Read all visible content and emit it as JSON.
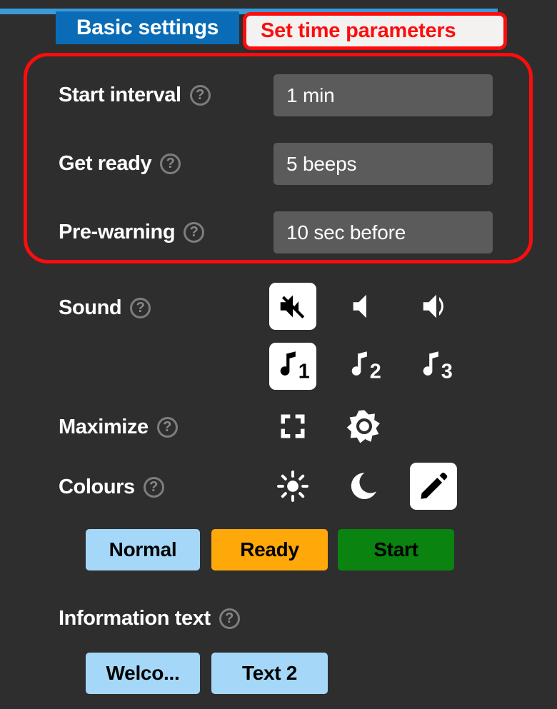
{
  "tab": {
    "active_label": "Basic settings"
  },
  "callout": {
    "text": "Set time parameters",
    "border_color": "#fc0d0d",
    "text_color": "#fc0d0d",
    "fill_color": "#f4f2f1"
  },
  "time_settings": {
    "rows": [
      {
        "label": "Start interval",
        "value": "1 min",
        "help": "help-icon"
      },
      {
        "label": "Get ready",
        "value": "5 beeps",
        "help": "help-icon"
      },
      {
        "label": "Pre-warning",
        "value": "10 sec before",
        "help": "help-icon"
      }
    ]
  },
  "sound": {
    "label": "Sound",
    "options_row1": [
      {
        "icon": "volume-mute-icon",
        "selected": true
      },
      {
        "icon": "volume-low-icon",
        "selected": false
      },
      {
        "icon": "volume-high-icon",
        "selected": false
      }
    ],
    "options_row2": [
      {
        "icon": "music-note-1-icon",
        "number": "1",
        "selected": true
      },
      {
        "icon": "music-note-2-icon",
        "number": "2",
        "selected": false
      },
      {
        "icon": "music-note-3-icon",
        "number": "3",
        "selected": false
      }
    ]
  },
  "maximize": {
    "label": "Maximize",
    "options": [
      {
        "icon": "fullscreen-icon",
        "selected": false
      },
      {
        "icon": "brightness-icon",
        "selected": false
      }
    ]
  },
  "colours": {
    "label": "Colours",
    "options": [
      {
        "icon": "sun-icon",
        "selected": false
      },
      {
        "icon": "moon-icon",
        "selected": false
      },
      {
        "icon": "pencil-icon",
        "selected": true
      }
    ],
    "chips": [
      {
        "label": "Normal",
        "color": "#a5d8f8"
      },
      {
        "label": "Ready",
        "color": "#ffa80a"
      },
      {
        "label": "Start",
        "color": "#0a8310"
      }
    ]
  },
  "information_text": {
    "label": "Information text",
    "buttons": [
      {
        "label": "Welco...",
        "color": "#a5d8f8"
      },
      {
        "label": "Text 2",
        "color": "#a5d8f8"
      }
    ]
  },
  "theme": {
    "background": "#2e2e2e",
    "field_bg": "#5b5b5b",
    "tab_blue": "#0a6cb6",
    "tab_strip_blue": "#3b9ad9",
    "label_color": "#ffffff"
  }
}
